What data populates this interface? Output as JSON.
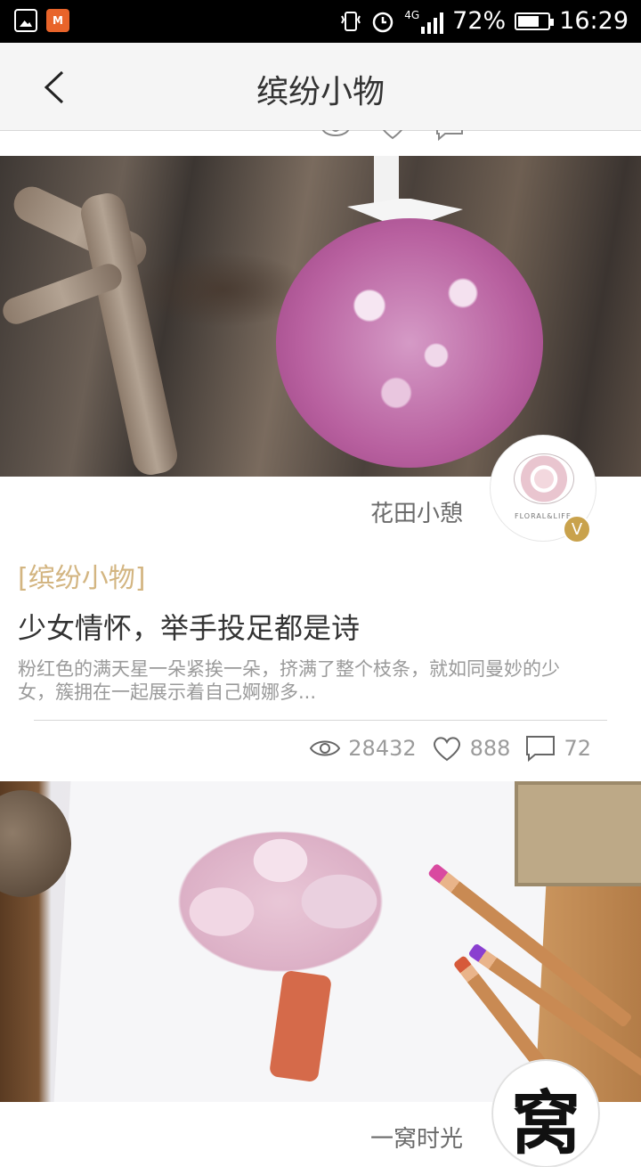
{
  "status_bar": {
    "network": "4G",
    "battery": "72%",
    "battery_level": 0.72,
    "time": "16:29",
    "icons": [
      "gallery-icon",
      "app-icon",
      "vibrate-icon",
      "alarm-icon",
      "signal-icon",
      "battery-icon"
    ]
  },
  "header": {
    "title": "缤纷小物",
    "back_icon": "chevron-left-icon"
  },
  "articles": [
    {
      "author": "花田小憩",
      "verified_badge": "V",
      "avatar_caption": "FLORAL&LIFE",
      "category": "[缤纷小物]",
      "title": "少女情怀，举手投足都是诗",
      "summary": "粉红色的满天星一朵紧挨一朵，挤满了整个枝条，就如同曼妙的少女，簇拥在一起展示着自己婀娜多...",
      "views": "28432",
      "likes": "888",
      "comments": "72"
    },
    {
      "author": "一窝时光",
      "avatar_glyph": "窝"
    }
  ],
  "colors": {
    "category": "#d3b581",
    "badge": "#c9a24c",
    "title_text": "#333333",
    "meta_text": "#9b9b9b"
  }
}
